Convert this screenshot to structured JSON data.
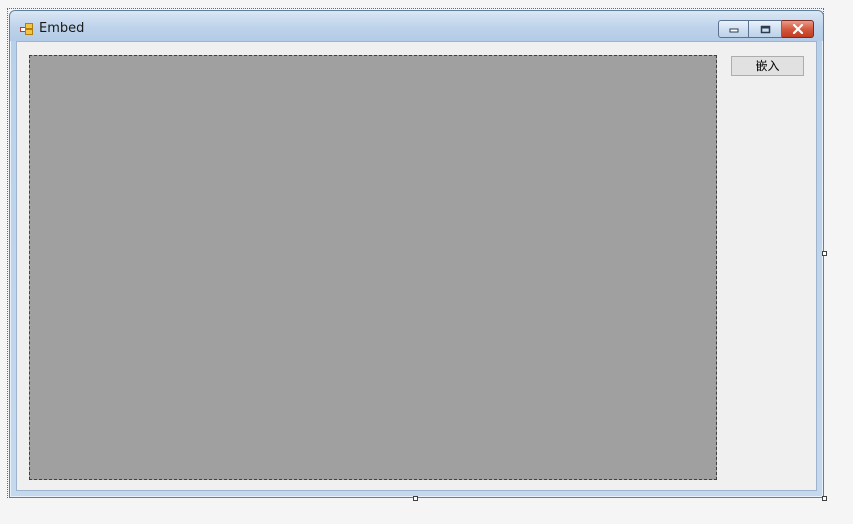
{
  "window": {
    "title": "Embed",
    "icon": "form-icon",
    "caption_buttons": [
      "minimize-icon",
      "maximize-icon",
      "close-icon"
    ]
  },
  "toolbar": {
    "embed_label": "嵌入"
  },
  "colors": {
    "panel_fill": "#a0a0a0",
    "client_background": "#f0f0f0",
    "title_bar": "#bfd4eb",
    "close_button": "#d45a40"
  }
}
